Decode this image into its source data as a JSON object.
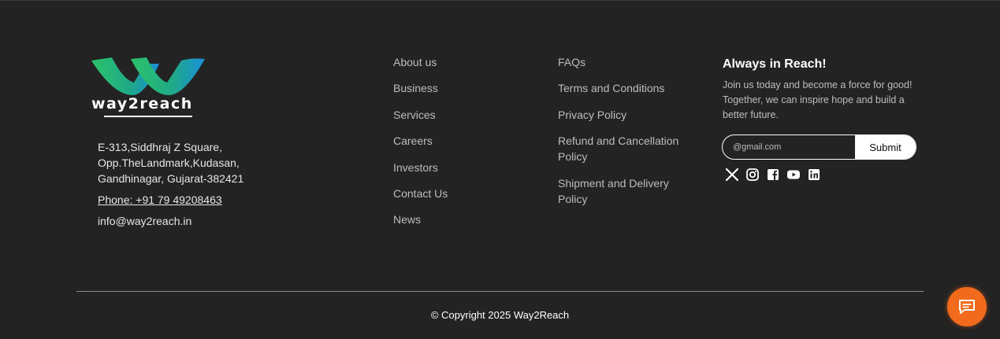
{
  "brand": {
    "logo_text": "way2reach"
  },
  "contact": {
    "address_lines": [
      "E-313,Siddhraj Z Square,",
      "Opp.TheLandmark,Kudasan,",
      "Gandhinagar, Gujarat-382421"
    ],
    "phone": "Phone: +91 79 49208463",
    "email": "info@way2reach.in"
  },
  "links_col1": [
    "About us",
    "Business",
    "Services",
    "Careers",
    "Investors",
    "Contact Us",
    "News"
  ],
  "links_col2": [
    "FAQs",
    "Terms and Conditions",
    "Privacy Policy",
    "Refund and Cancellation Policy",
    "Shipment and Delivery Policy"
  ],
  "newsletter": {
    "heading": "Always in Reach!",
    "text": "Join us today and become a force for good! Together, we can inspire hope and build a better future.",
    "placeholder": "@gmail.com",
    "submit_label": "Submit"
  },
  "social_icons": [
    "x-icon",
    "instagram-icon",
    "facebook-icon",
    "youtube-icon",
    "linkedin-icon"
  ],
  "footer": {
    "copyright": "© Copyright 2025 Way2Reach"
  },
  "colors": {
    "background": "#232323",
    "accent": "#f26a1b",
    "logo_green": "#2cc36b",
    "logo_blue": "#1a8fd8"
  }
}
